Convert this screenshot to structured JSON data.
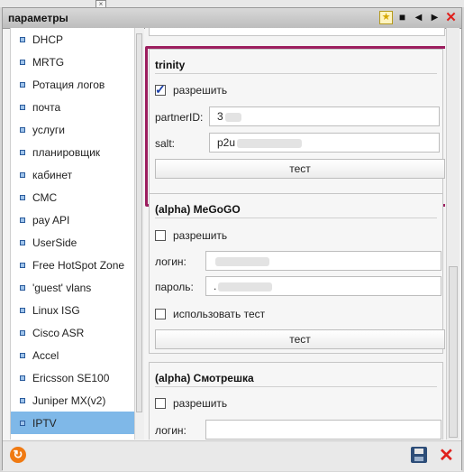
{
  "window": {
    "title": "параметры",
    "toolbar_icons": [
      "star-icon",
      "maximize-icon",
      "arrow-left-icon",
      "arrow-right-icon",
      "close-icon"
    ],
    "accent": "#9c1e5f"
  },
  "sidebar": {
    "items": [
      {
        "label": "DHCP"
      },
      {
        "label": "MRTG"
      },
      {
        "label": "Ротация логов"
      },
      {
        "label": "почта"
      },
      {
        "label": "услуги"
      },
      {
        "label": "планировщик"
      },
      {
        "label": "кабинет"
      },
      {
        "label": "СМС"
      },
      {
        "label": "pay API"
      },
      {
        "label": "UserSide"
      },
      {
        "label": "Free HotSpot Zone"
      },
      {
        "label": "'guest' vlans"
      },
      {
        "label": "Linux ISG"
      },
      {
        "label": "Cisco ASR"
      },
      {
        "label": "Accel"
      },
      {
        "label": "Ericsson SE100"
      },
      {
        "label": "Juniper MX(v2)"
      },
      {
        "label": "IPTV",
        "selected": true
      }
    ],
    "selected_color": "#7fb8e8"
  },
  "sections": {
    "trinity": {
      "title": "trinity",
      "allow_label": "разрешить",
      "allow_checked": true,
      "partner_label": "partnerID:",
      "partner_value": "3",
      "salt_label": "salt:",
      "salt_value": "p2u",
      "test_button": "тест"
    },
    "megogo": {
      "title": "(alpha) MeGoGO",
      "allow_label": "разрешить",
      "allow_checked": false,
      "login_label": "логин:",
      "login_value": "",
      "password_label": "пароль:",
      "password_value": ".",
      "use_test_label": "использовать тест",
      "use_test_checked": false,
      "test_button": "тест"
    },
    "smotreshka": {
      "title": "(alpha) Смотрешка",
      "allow_label": "разрешить",
      "allow_checked": false,
      "login_label": "логин:",
      "login_value": ""
    }
  },
  "bottombar": {
    "icons": [
      "refresh-icon",
      "save-icon",
      "cancel-icon"
    ]
  }
}
